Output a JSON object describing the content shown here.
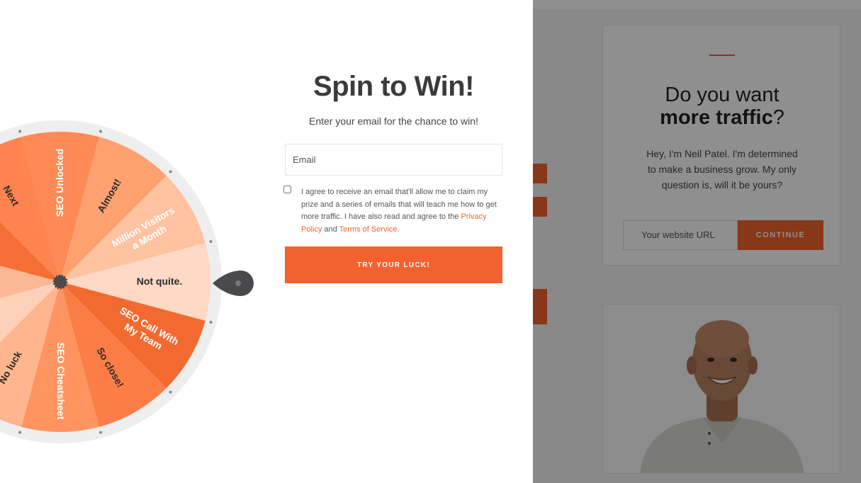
{
  "modal": {
    "title": "Spin to Win!",
    "subtitle": "Enter your email for the chance to win!",
    "email_placeholder": "Email",
    "consent_text": "I agree to receive an email that'll allow me to claim my prize and a series of emails that will teach me how to get more traffic. I have also read and agree to the",
    "privacy_link": "Privacy Policy",
    "consent_and": "and",
    "terms_link": "Terms of Service",
    "consent_end": ".",
    "button_label": "TRY YOUR LUCK!"
  },
  "wheel": {
    "segments": [
      {
        "label": "SEO Unlocked",
        "color": "#ff8a55"
      },
      {
        "label": "Almost!",
        "color": "#ffa070"
      },
      {
        "label": "Million Visitors a Month",
        "color": "#ffc3a1"
      },
      {
        "label": "Not quite.",
        "color": "#fdd9c6"
      },
      {
        "label": "SEO Call With My Team",
        "color": "#f36a30"
      },
      {
        "label": "So close!",
        "color": "#fd7d46"
      },
      {
        "label": "SEO Cheatsheet",
        "color": "#ff9460"
      },
      {
        "label": "No luck",
        "color": "#ffb58e"
      },
      {
        "label": "",
        "color": "#fdd0b8"
      },
      {
        "label": "",
        "color": "#fbb894"
      },
      {
        "label": "",
        "color": "#f66e35"
      },
      {
        "label": "Next",
        "color": "#ff8450"
      }
    ],
    "colors": {
      "rim": "#eeeeef",
      "pointer": "#4a4a4c",
      "hub": "#4a4a4c"
    }
  },
  "background_page": {
    "headline_part1": "Do you want",
    "headline_bold": "more traffic",
    "headline_end": "?",
    "subtext": "Hey, I'm Neil Patel. I'm determined to make a business grow. My only question is, will it be yours?",
    "url_placeholder": "Your website URL",
    "continue_label": "CONTINUE"
  },
  "colors": {
    "accent": "#f3622e",
    "title": "#3b3b3b"
  }
}
